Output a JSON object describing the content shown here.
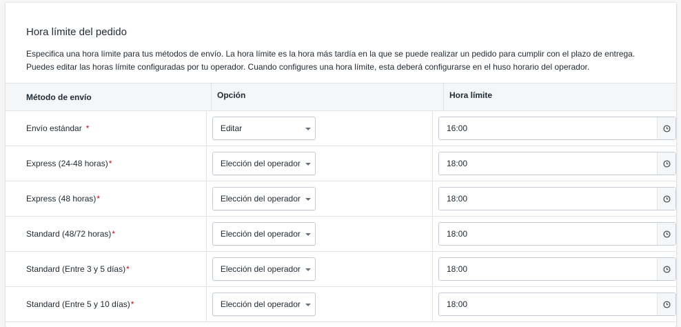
{
  "section": {
    "title": "Hora límite del pedido",
    "description": "Especifica una hora límite para tus métodos de envío. La hora límite es la hora más tardía en la que se puede realizar un pedido para cumplir con el plazo de entrega. Puedes editar las horas límite configuradas por tu operador. Cuando configures una hora límite, esta deberá configurarse en el huso horario del operador."
  },
  "table": {
    "headers": {
      "method": "Método de envío",
      "option": "Opción",
      "cutoff": "Hora límite"
    },
    "required_marker": "*",
    "rows": [
      {
        "method": "Envío estándar",
        "option": "Editar",
        "time": "16:00"
      },
      {
        "method": "Express (24-48 horas)",
        "option": "Elección del operador",
        "time": "18:00"
      },
      {
        "method": "Express (48 horas)",
        "option": "Elección del operador",
        "time": "18:00"
      },
      {
        "method": "Standard (48/72 horas)",
        "option": "Elección del operador",
        "time": "18:00"
      },
      {
        "method": "Standard (Entre 3 y 5 días)",
        "option": "Elección del operador",
        "time": "18:00"
      },
      {
        "method": "Standard (Entre 5 y 10 días)",
        "option": "Elección del operador",
        "time": "18:00"
      }
    ]
  },
  "icons": {
    "select": "chevron-down-icon",
    "time": "clock-icon"
  },
  "colors": {
    "required": "#bf0711",
    "border": "#dfe3e8",
    "header_bg": "#f4f6f8"
  }
}
